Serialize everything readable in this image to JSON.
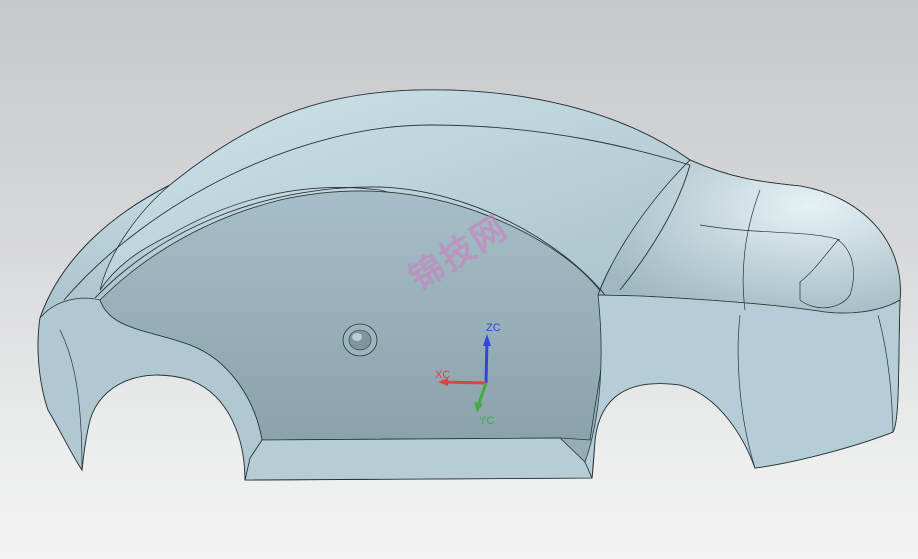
{
  "viewport": {
    "background_top": "#c6c8cb",
    "background_bottom": "#f3f3f3",
    "model_color": "#a9c3cc"
  },
  "model": {
    "name_icon": "car-body-shell-icon"
  },
  "triad": {
    "z_label": "ZC",
    "x_label": "XC",
    "y_label": "YC",
    "z_color": "#3344dd",
    "x_color": "#dd4444",
    "y_color": "#44aa44"
  },
  "watermark": {
    "text": "锦技网"
  }
}
